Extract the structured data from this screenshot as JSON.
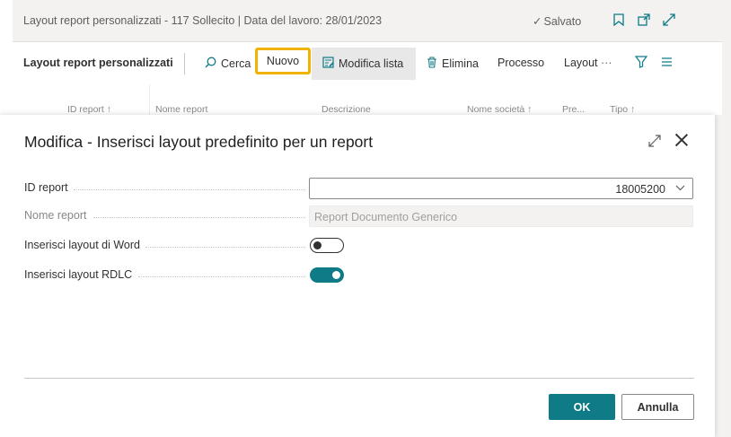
{
  "background": {
    "title": "Layout report personalizzati - 117 Sollecito | Data del lavoro: 28/01/2023",
    "saved_status": "Salvato",
    "toolbar": {
      "page_name": "Layout report personalizzati",
      "search": "Cerca",
      "new": "Nuovo",
      "edit_list": "Modifica lista",
      "delete": "Elimina",
      "process": "Processo",
      "layout": "Layout",
      "more": "···"
    },
    "columns": [
      "ID report ↑",
      "Nome report",
      "Descrizione",
      "Nome società ↑",
      "Pre...",
      "Tipo ↑"
    ]
  },
  "dialog": {
    "title": "Modifica - Inserisci layout predefinito per un report",
    "fields": [
      {
        "label": "ID report",
        "value": "18005200"
      },
      {
        "label": "Nome report",
        "value": "Report Documento Generico"
      },
      {
        "label": "Inserisci layout di Word",
        "value": "off"
      },
      {
        "label": "Inserisci layout RDLC",
        "value": "on"
      }
    ],
    "ok_label": "OK",
    "cancel_label": "Annulla"
  },
  "colors": {
    "accent": "#0f7b87",
    "highlight": "#f0b400"
  }
}
